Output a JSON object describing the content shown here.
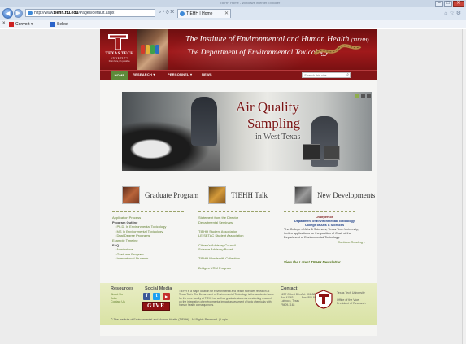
{
  "browser": {
    "window_title": "TIEHH Home - Windows Internet Explorer",
    "address": {
      "prefix": "http://www.",
      "host": "tiehh.ttu.edu",
      "path": "/Pages/default.aspx"
    },
    "address_tools": "⌕ • ⊙ ✕",
    "tab_label": "TIEHH | Home",
    "command_bar": {
      "convert_label": "Convert",
      "select_label": "Select"
    }
  },
  "header": {
    "logo": {
      "name": "TEXAS TECH",
      "sub": "UNIVERSITY",
      "tagline": "From here, it's possible."
    },
    "title_line1_pre": "The Institute of Environmental and Human Health",
    "title_line1_abbr": "(TIEHH)",
    "title_line2": "The Department of Environmental Toxicology"
  },
  "nav": {
    "home": "HOME",
    "research": "RESEARCH",
    "personnel": "PERSONNEL",
    "news": "NEWS",
    "dropdown_marker": "▾",
    "search_placeholder": "Search this site...",
    "search_glyph": "⌕"
  },
  "hero": {
    "line1": "Air Quality",
    "line2": "Sampling",
    "line3": "in West Texas",
    "slide_count": 3,
    "active_slide": 1
  },
  "columns": [
    {
      "title": "Graduate Program",
      "thumb_color": "#9a4a2a"
    },
    {
      "title": "TIEHH Talk",
      "thumb_color": "#b07a30"
    },
    {
      "title": "New Developments",
      "thumb_color": "#6d6d6d"
    }
  ],
  "grad_links": {
    "application": "Application Process",
    "outline": "Program Outline",
    "phd": "• Ph.D. In Environmental Toxicology",
    "ms": "• MS In Environmental Toxicology",
    "dual": "• Dual Degree Programs",
    "timeline": "Example Timeline",
    "faq": "FAQ",
    "admissions": "• Admissions",
    "graduate": "• Graduate Program",
    "international": "• International Students"
  },
  "talk_links": {
    "director": "Statement from the Director",
    "seminars": "Departmental Seminars",
    "assoc": "TIEHH Student Association",
    "setac": "LE-SETAC Student Association",
    "citizen": "Citizen's Advisory Council",
    "science": "Science Advisory Board",
    "wordsmith": "TIEHH Wordsmith Collection",
    "bridges": "Bridges URM Program"
  },
  "news": {
    "heading": "Chairperson",
    "dept": "Department of Environmental Toxicology",
    "college": "College of Arts & Sciences",
    "body": "The College of Arts & Sciences, Texas Tech University, invites applications for the position of Chair of the Department of Environmental Toxicology.",
    "more": "Continue Reading »",
    "latest": "View the Latest TIEHH Newsletter"
  },
  "footer": {
    "resources_heading": "Resources",
    "social_heading": "Social Media",
    "contact_heading": "Contact",
    "about": "About Us",
    "jobs": "Jobs",
    "contact_us": "Contact Us",
    "give": "GIVE",
    "about_text": "TIEHH is a major location for environmental and health sciences research at Texas Tech. The Department of Environmental Toxicology is the academic home for the core faculty at TIEHH as well as graduate students conducting research on the integration of environmental impact assessment of toxic chemicals with human health consequences.",
    "addr1": "1207 Gilbert Drive",
    "addr2": "Box 41163",
    "addr3": "Lubbock, Texas",
    "addr4": "79409-1163",
    "tel": "Tel: 806-885-4567",
    "fax": "Fax: 806-885-2132",
    "ttu": "Texas Tech University",
    "vp1": "Office of the Vice",
    "vp2": "President of Research",
    "copyright": "© The Institute of Environmental and Human Health (TIEHH) - All Rights Reserved. | Login |"
  },
  "colors": {
    "brand_red": "#a0191b",
    "nav_red": "#841517",
    "link_green": "#5e7d2a",
    "footer_green": "#d9e2a4"
  }
}
